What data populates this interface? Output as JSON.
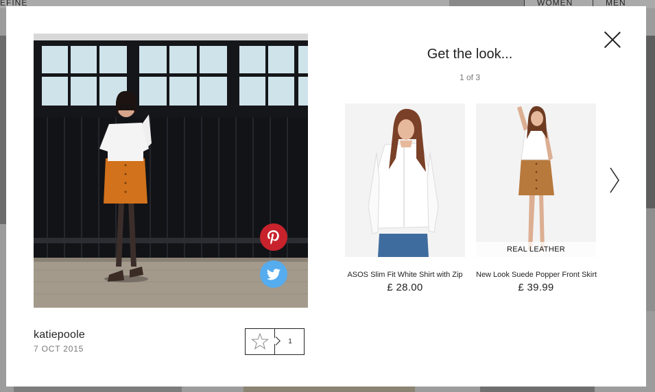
{
  "background": {
    "refine_label": "EFINE",
    "tabs": [
      "WOMEN",
      "MEN"
    ]
  },
  "modal": {
    "close_icon": "close-icon",
    "post": {
      "username": "katiepoole",
      "date": "7 OCT 2015",
      "favourite_count": "1",
      "share_icons": [
        "pinterest-icon",
        "twitter-icon"
      ]
    },
    "look": {
      "title": "Get the look...",
      "pager": "1 of 3",
      "products": [
        {
          "name": "ASOS Slim Fit White Shirt with Zip",
          "price": "£ 28.00",
          "badge": ""
        },
        {
          "name": "New Look Suede Popper Front Skirt",
          "price": "£ 39.99",
          "badge": "REAL LEATHER"
        }
      ],
      "next_icon": "chevron-right-icon"
    }
  },
  "colors": {
    "pinterest": "#c8232c",
    "twitter": "#55acee",
    "text": "#222222",
    "muted": "#777777"
  }
}
